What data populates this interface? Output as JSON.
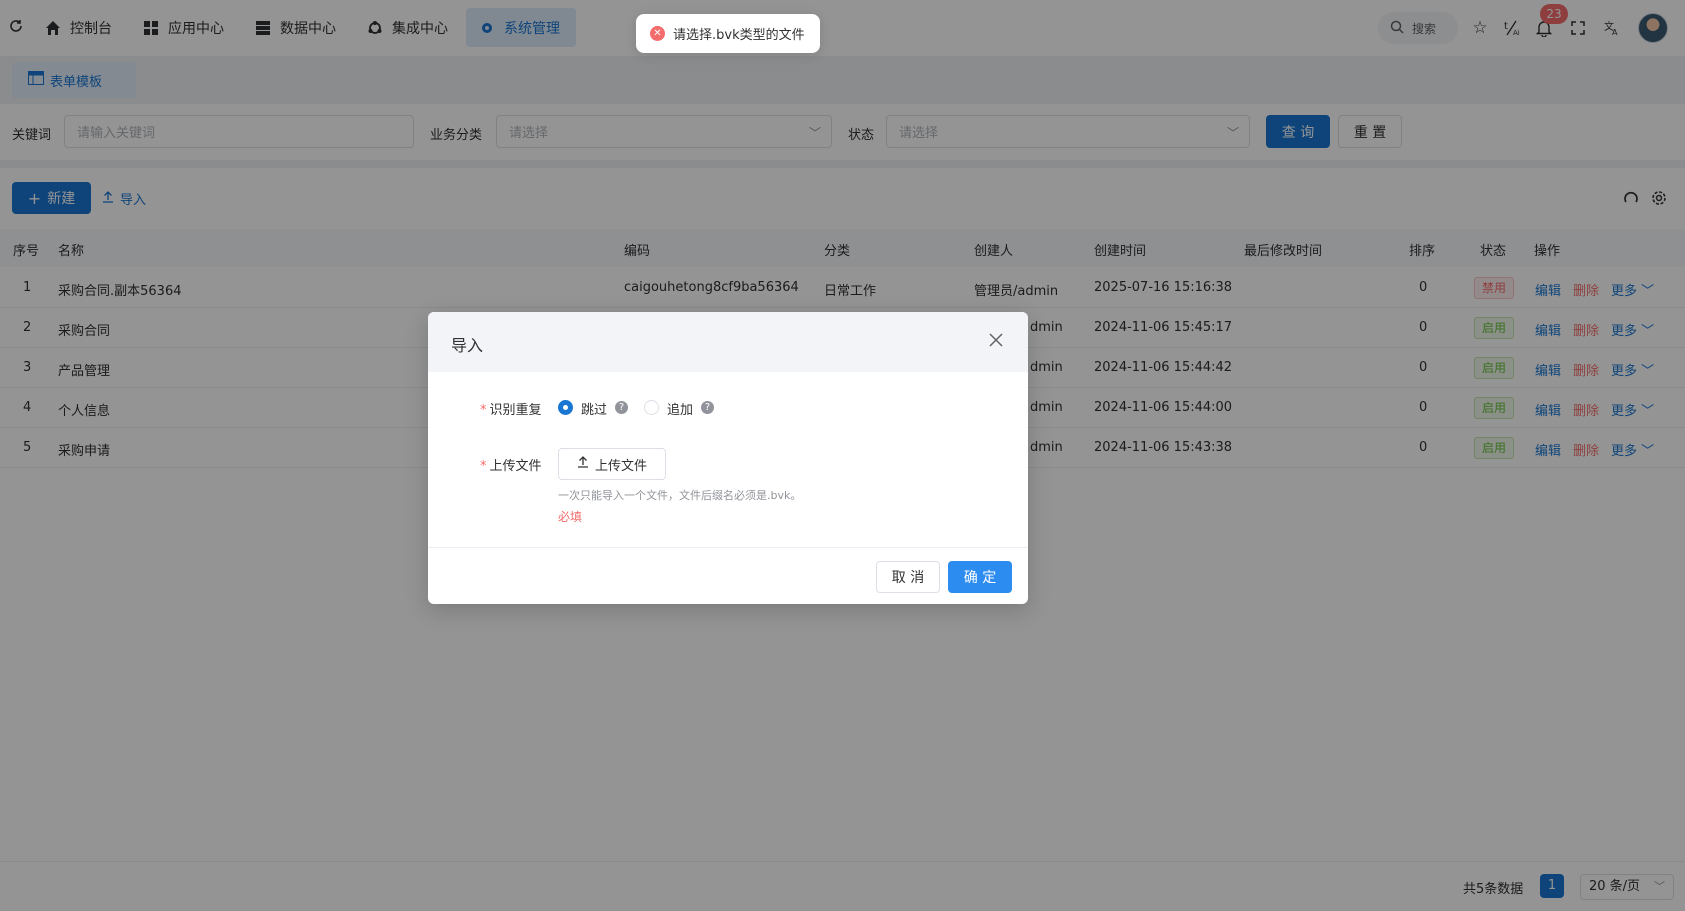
{
  "header": {
    "nav": [
      {
        "label": "控制台",
        "icon": "home-icon"
      },
      {
        "label": "应用中心",
        "icon": "grid-icon"
      },
      {
        "label": "数据中心",
        "icon": "database-icon"
      },
      {
        "label": "集成中心",
        "icon": "integration-icon"
      },
      {
        "label": "系统管理",
        "icon": "gear-icon",
        "active": true
      }
    ],
    "search_label": "搜索",
    "notification_count": "23"
  },
  "tabs": [
    {
      "label": "表单模板",
      "icon": "table-icon"
    }
  ],
  "filters": {
    "keyword_label": "关键词",
    "keyword_placeholder": "请输入关键词",
    "category_label": "业务分类",
    "category_placeholder": "请选择",
    "status_label": "状态",
    "status_placeholder": "请选择",
    "query_button": "查 询",
    "reset_button": "重 置"
  },
  "toolbar": {
    "new_button": "新建",
    "import_button": "导入"
  },
  "table": {
    "headers": [
      "序号",
      "名称",
      "编码",
      "分类",
      "创建人",
      "创建时间",
      "最后修改时间",
      "排序",
      "状态",
      "操作"
    ],
    "rows": [
      {
        "idx": "1",
        "name": "采购合同.副本56364",
        "code": "caigouhetong8cf9ba56364",
        "category": "日常工作",
        "creator": "管理员/admin",
        "created": "2025-07-16 15:16:38",
        "modified": "",
        "sort": "0",
        "status": "禁用",
        "status_type": "disabled"
      },
      {
        "idx": "2",
        "name": "采购合同",
        "code": "",
        "category": "",
        "creator": "dmin",
        "created": "2024-11-06 15:45:17",
        "modified": "",
        "sort": "0",
        "status": "启用",
        "status_type": "enabled"
      },
      {
        "idx": "3",
        "name": "产品管理",
        "code": "",
        "category": "",
        "creator": "dmin",
        "created": "2024-11-06 15:44:42",
        "modified": "",
        "sort": "0",
        "status": "启用",
        "status_type": "enabled"
      },
      {
        "idx": "4",
        "name": "个人信息",
        "code": "",
        "category": "",
        "creator": "dmin",
        "created": "2024-11-06 15:44:00",
        "modified": "",
        "sort": "0",
        "status": "启用",
        "status_type": "enabled"
      },
      {
        "idx": "5",
        "name": "采购申请",
        "code": "",
        "category": "",
        "creator": "dmin",
        "created": "2024-11-06 15:43:38",
        "modified": "",
        "sort": "0",
        "status": "启用",
        "status_type": "enabled"
      }
    ],
    "actions": {
      "edit": "编辑",
      "delete": "删除",
      "more": "更多"
    }
  },
  "pagination": {
    "total_text": "共5条数据",
    "current_page": "1",
    "page_size": "20 条/页"
  },
  "dialog": {
    "title": "导入",
    "duplicate_label": "识别重复",
    "option_skip": "跳过",
    "option_append": "追加",
    "selected_option": "跳过",
    "upload_label": "上传文件",
    "upload_button": "上传文件",
    "upload_hint": "一次只能导入一个文件，文件后缀名必须是.bvk。",
    "required_error": "必填",
    "cancel_button": "取 消",
    "confirm_button": "确 定"
  },
  "toast": {
    "message": "请选择.bvk类型的文件",
    "type": "error"
  },
  "colors": {
    "primary": "#1976d2",
    "danger": "#f56c6c",
    "success": "#67c23a"
  }
}
